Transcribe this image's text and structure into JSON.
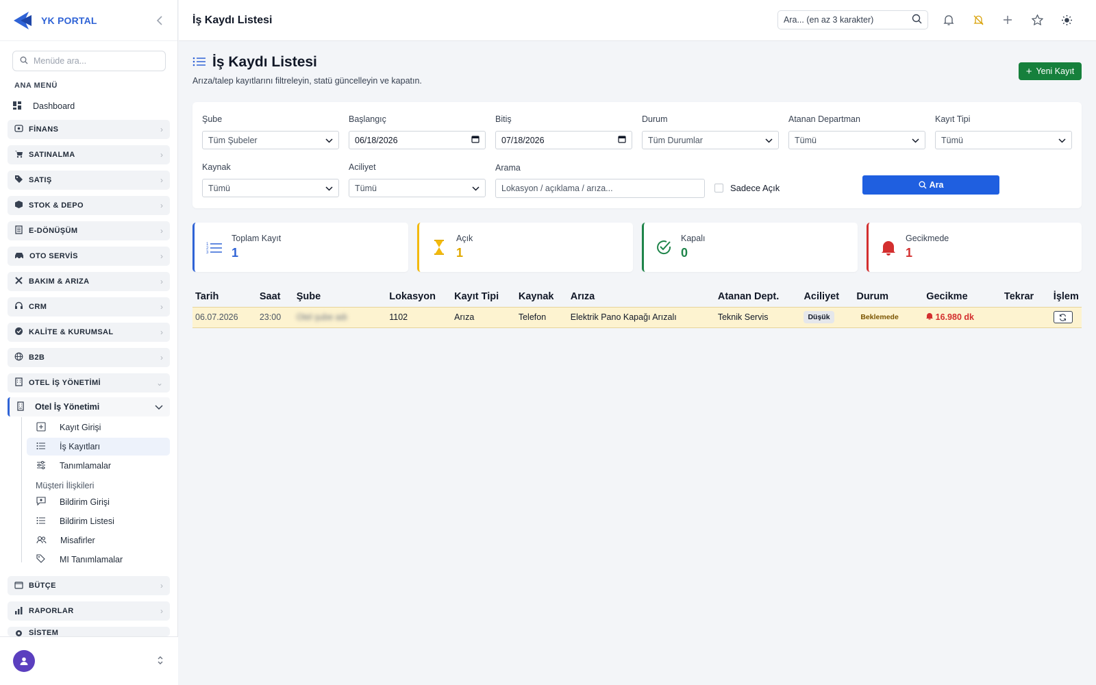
{
  "brand": {
    "name": "YK PORTAL"
  },
  "sidebar": {
    "search_placeholder": "Menüde ara...",
    "section_label": "ANA MENÜ",
    "dashboard": "Dashboard",
    "groups": [
      {
        "label": "FİNANS",
        "icon": "finance-icon"
      },
      {
        "label": "SATINALMA",
        "icon": "cart-icon"
      },
      {
        "label": "SATIŞ",
        "icon": "tag-icon"
      },
      {
        "label": "STOK & DEPO",
        "icon": "box-icon"
      },
      {
        "label": "E-DÖNÜŞÜM",
        "icon": "document-icon"
      },
      {
        "label": "OTO SERVİS",
        "icon": "car-icon"
      },
      {
        "label": "BAKIM & ARIZA",
        "icon": "tools-icon"
      },
      {
        "label": "CRM",
        "icon": "headset-icon"
      },
      {
        "label": "KALİTE & KURUMSAL",
        "icon": "quality-icon"
      },
      {
        "label": "B2B",
        "icon": "globe-icon"
      },
      {
        "label": "OTEL İŞ YÖNETİMİ",
        "icon": "hotel-icon"
      }
    ],
    "open_sub": "Otel İş Yönetimi",
    "sub_items": [
      {
        "label": "Kayıt Girişi",
        "icon": "plus-square-icon"
      },
      {
        "label": "İş Kayıtları",
        "icon": "list-icon",
        "active": true
      },
      {
        "label": "Tanımlamalar",
        "icon": "sliders-icon"
      }
    ],
    "sub_caption": "Müşteri İlişkileri",
    "sub_items2": [
      {
        "label": "Bildirim Girişi",
        "icon": "message-icon"
      },
      {
        "label": "Bildirim Listesi",
        "icon": "list-icon"
      },
      {
        "label": "Misafirler",
        "icon": "users-icon"
      },
      {
        "label": "MI Tanımlamalar",
        "icon": "tags-icon"
      }
    ],
    "bottom_groups": [
      {
        "label": "BÜTÇE",
        "icon": "wallet-icon"
      },
      {
        "label": "RAPORLAR",
        "icon": "chart-icon"
      },
      {
        "label": "SİSTEM",
        "icon": "gear-icon"
      }
    ]
  },
  "topbar": {
    "title": "İş Kaydı Listesi",
    "search_placeholder": "Ara... (en az 3 karakter)"
  },
  "page": {
    "title": "İş Kaydı Listesi",
    "subtitle": "Arıza/talep kayıtlarını filtreleyin, statü güncelleyin ve kapatın.",
    "new_button": "Yeni Kayıt"
  },
  "filters": {
    "sube": {
      "label": "Şube",
      "value": "Tüm Şubeler"
    },
    "baslangic": {
      "label": "Başlangıç",
      "value": "06/18/2026"
    },
    "bitis": {
      "label": "Bitiş",
      "value": "07/18/2026"
    },
    "durum": {
      "label": "Durum",
      "value": "Tüm Durumlar"
    },
    "departman": {
      "label": "Atanan Departman",
      "value": "Tümü"
    },
    "kayit_tipi": {
      "label": "Kayıt Tipi",
      "value": "Tümü"
    },
    "kaynak": {
      "label": "Kaynak",
      "value": "Tümü"
    },
    "aciliyet": {
      "label": "Aciliyet",
      "value": "Tümü"
    },
    "arama": {
      "label": "Arama",
      "placeholder": "Lokasyon / açıklama / arıza..."
    },
    "only_open": "Sadece Açık",
    "search_button": "Ara"
  },
  "stats": [
    {
      "label": "Toplam Kayıt",
      "value": "1",
      "color": "#2f63d6",
      "icon": "list-icon"
    },
    {
      "label": "Açık",
      "value": "1",
      "color": "#f2b90c",
      "icon": "hourglass-icon"
    },
    {
      "label": "Kapalı",
      "value": "0",
      "color": "#1e8449",
      "icon": "check-circle-icon"
    },
    {
      "label": "Gecikmede",
      "value": "1",
      "color": "#d32f2f",
      "icon": "bell-icon"
    }
  ],
  "table": {
    "headers": [
      "Tarih",
      "Saat",
      "Şube",
      "Lokasyon",
      "Kayıt Tipi",
      "Kaynak",
      "Arıza",
      "Atanan Dept.",
      "Aciliyet",
      "Durum",
      "Gecikme",
      "Tekrar",
      "İşlem"
    ],
    "rows": [
      {
        "tarih": "06.07.2026",
        "saat": "23:00",
        "sube": "Otel şube adı",
        "lokasyon": "1102",
        "kayit_tipi": "Arıza",
        "kaynak": "Telefon",
        "ariza": "Elektrik Pano Kapağı Arızalı",
        "dept": "Teknik Servis",
        "aciliyet": "Düşük",
        "durum": "Beklemede",
        "gecikme": "16.980 dk",
        "tekrar": ""
      }
    ]
  }
}
